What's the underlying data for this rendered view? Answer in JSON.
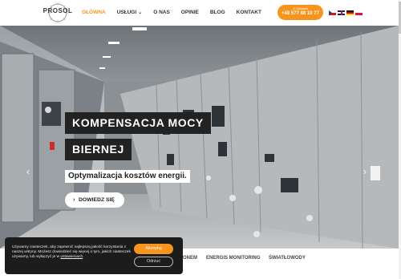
{
  "brand": {
    "logo_text": "PROSOL"
  },
  "nav": {
    "items": [
      {
        "label": "GŁÓWNA",
        "active": true,
        "dropdown": false
      },
      {
        "label": "USŁUGI",
        "active": false,
        "dropdown": true
      },
      {
        "label": "O NAS",
        "active": false,
        "dropdown": false
      },
      {
        "label": "OPINIE",
        "active": false,
        "dropdown": false
      },
      {
        "label": "BLOG",
        "active": false,
        "dropdown": false
      },
      {
        "label": "KONTAKT",
        "active": false,
        "dropdown": false
      }
    ],
    "dropdown_icon": "chevron-down-icon"
  },
  "contact": {
    "label": "Zadzwoń",
    "phone": "+48 577 88 10 77",
    "icon": "phone-icon"
  },
  "languages": [
    "cz",
    "gb",
    "de",
    "pl"
  ],
  "hero": {
    "headline_line1": "KOMPENSACJA MOCY",
    "headline_line2": "BIERNEJ",
    "subline": "Optymalizacja kosztów energii.",
    "cta_label": "DOWIEDZ SIĘ",
    "prev_icon": "chevron-left-icon",
    "next_icon": "chevron-right-icon"
  },
  "tabs": {
    "items": [
      "ONEM",
      "ENERGIS MONITORING",
      "ŚWIATŁOWODY"
    ]
  },
  "cookie": {
    "text": "Używamy ciasteczek, aby zapewnić najlepszą jakość korzystania z naszej witryny. Możesz dowiedzieć się więcej o tym, jakich ciasteczek używamy, lub wyłączyć je w ",
    "policy_link": "ustawieniach",
    "text_end": ".",
    "accept_label": "Akceptuj",
    "reject_label": "Odrzuć"
  },
  "colors": {
    "accent": "#f7941d",
    "dark": "#222222",
    "cookie_bg": "#1c1c1c"
  }
}
